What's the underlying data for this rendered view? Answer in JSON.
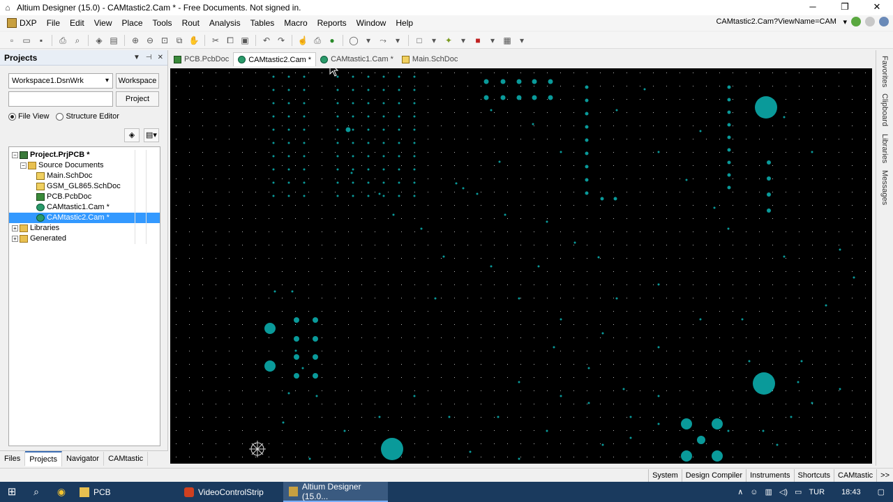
{
  "window": {
    "title": "Altium Designer (15.0) - CAMtastic2.Cam * - Free Documents. Not signed in.",
    "controls": [
      "minimize-icon",
      "restore-icon",
      "close-icon"
    ]
  },
  "menubar": {
    "items": [
      "DXP",
      "File",
      "Edit",
      "View",
      "Place",
      "Tools",
      "Rout",
      "Analysis",
      "Tables",
      "Macro",
      "Reports",
      "Window",
      "Help"
    ],
    "viewname": "CAMtastic2.Cam?ViewName=CAM"
  },
  "panel": {
    "title": "Projects",
    "workspace_select": "Workspace1.DsnWrk",
    "workspace_button": "Workspace",
    "project_button": "Project",
    "radio_file_view": "File View",
    "radio_structure_editor": "Structure Editor",
    "tree": [
      {
        "label": "Project.PrjPCB *",
        "level": 0,
        "icon": "proj",
        "bold": true,
        "expander": "−"
      },
      {
        "label": "Source Documents",
        "level": 1,
        "icon": "folder",
        "expander": "−"
      },
      {
        "label": "Main.SchDoc",
        "level": 2,
        "icon": "sch"
      },
      {
        "label": "GSM_GL865.SchDoc",
        "level": 2,
        "icon": "sch"
      },
      {
        "label": "PCB.PcbDoc",
        "level": 2,
        "icon": "pcb"
      },
      {
        "label": "CAMtastic1.Cam *",
        "level": 2,
        "icon": "cam"
      },
      {
        "label": "CAMtastic2.Cam *",
        "level": 2,
        "icon": "cam",
        "selected": true
      },
      {
        "label": "Libraries",
        "level": 0,
        "icon": "folder",
        "expander": "+"
      },
      {
        "label": "Generated",
        "level": 0,
        "icon": "folder",
        "expander": "+"
      }
    ],
    "bottom_tabs": [
      "Files",
      "Projects",
      "Navigator",
      "CAMtastic"
    ],
    "active_bottom_tab": "Projects"
  },
  "doc_tabs": [
    {
      "label": "PCB.PcbDoc",
      "icon": "pcb"
    },
    {
      "label": "CAMtastic2.Cam *",
      "icon": "cam",
      "active": true
    },
    {
      "label": "CAMtastic1.Cam *",
      "icon": "cam"
    },
    {
      "label": "Main.SchDoc",
      "icon": "sch"
    }
  ],
  "right_sidebar": [
    "Favorites",
    "Clipboard",
    "Libraries",
    "Messages"
  ],
  "statusbar": [
    "System",
    "Design Compiler",
    "Instruments",
    "Shortcuts",
    "CAMtastic",
    ">>"
  ],
  "taskbar": {
    "apps": [
      {
        "label": "PCB",
        "icon": "folder"
      },
      {
        "label": "VideoControlStrip",
        "icon": "record"
      },
      {
        "label": "Altium Designer (15.0...",
        "icon": "altium",
        "active": true
      }
    ],
    "language": "TUR",
    "time": "18:43"
  },
  "colors": {
    "canvas_bg": "#000000",
    "pad": "#0a9a9a",
    "grid_dot": "#bbbbbb",
    "selection": "#3399ff"
  }
}
